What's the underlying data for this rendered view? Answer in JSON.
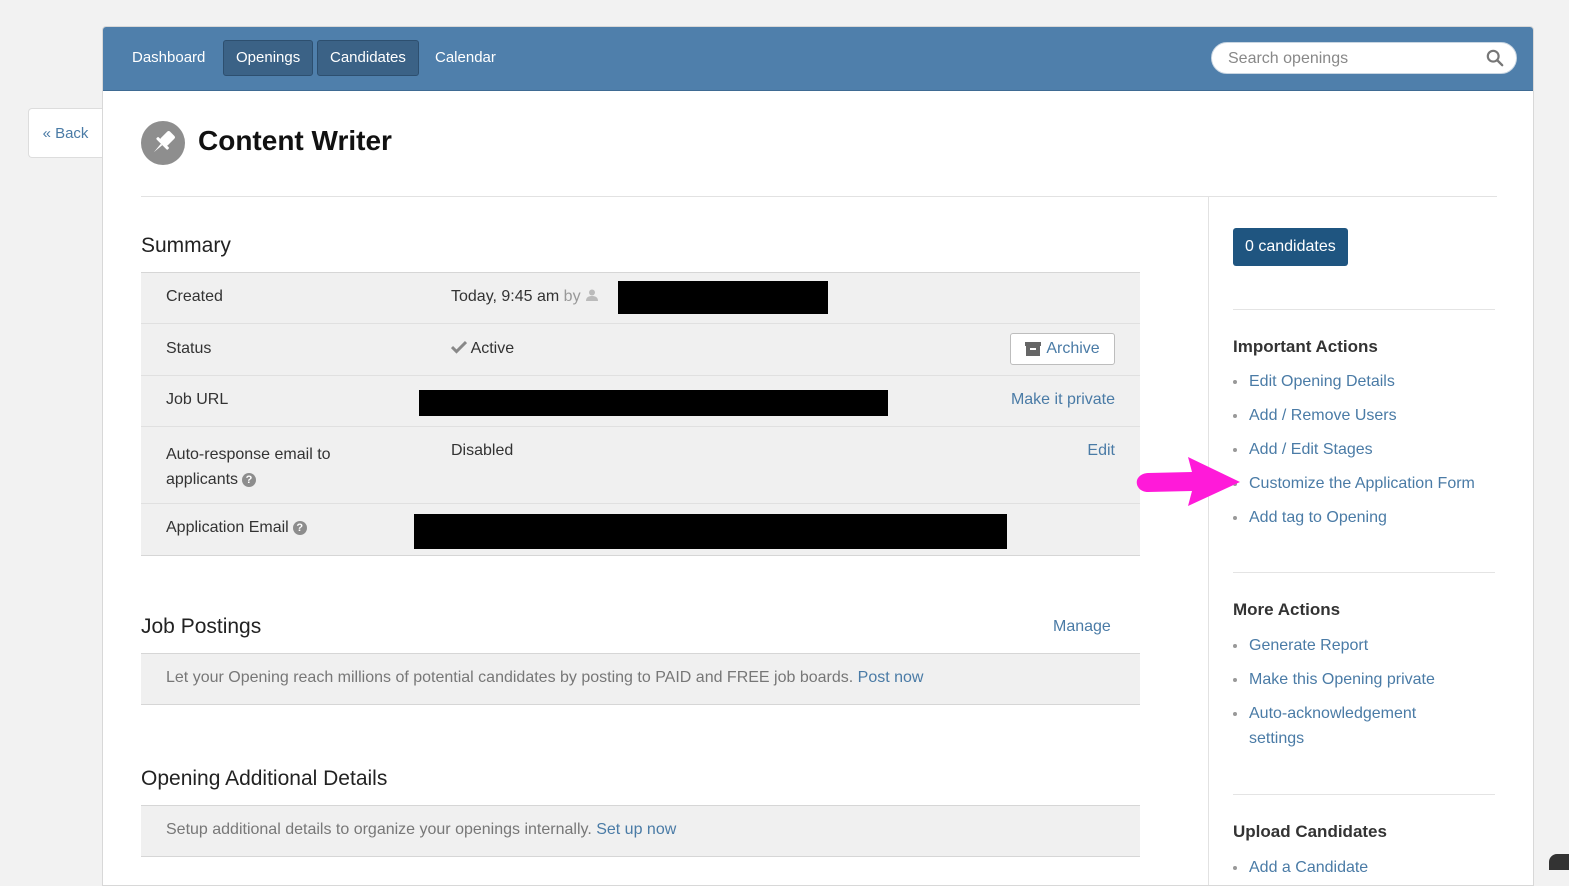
{
  "back": {
    "label": "« Back"
  },
  "nav": {
    "items": [
      {
        "label": "Dashboard"
      },
      {
        "label": "Openings"
      },
      {
        "label": "Candidates"
      },
      {
        "label": "Calendar"
      }
    ],
    "search_placeholder": "Search openings"
  },
  "page": {
    "title": "Content Writer"
  },
  "summary": {
    "heading": "Summary",
    "created_label": "Created",
    "created_value": "Today, 9:45 am",
    "created_by": "by",
    "status_label": "Status",
    "status_value": "Active",
    "archive_label": "Archive",
    "job_url_label": "Job URL",
    "make_private_label": "Make it private",
    "autoresponse_label_line1": "Auto-response email to",
    "autoresponse_label_line2": "applicants",
    "autoresponse_value": "Disabled",
    "edit_label": "Edit",
    "app_email_label": "Application Email"
  },
  "job_postings": {
    "heading": "Job Postings",
    "manage_label": "Manage",
    "note": "Let your Opening reach millions of potential candidates by posting to PAID and FREE job boards.",
    "post_now_label": "Post now"
  },
  "additional": {
    "heading": "Opening Additional Details",
    "note": "Setup additional details to organize your openings internally.",
    "setup_label": "Set up now"
  },
  "sidebar": {
    "candidates_button": "0 candidates",
    "important_heading": "Important Actions",
    "important_items": [
      {
        "label": "Edit Opening Details"
      },
      {
        "label": "Add / Remove Users"
      },
      {
        "label": "Add / Edit Stages"
      },
      {
        "label": "Customize the Application Form"
      },
      {
        "label": "Add tag to Opening"
      }
    ],
    "more_heading": "More Actions",
    "more_items": [
      {
        "label": "Generate Report"
      },
      {
        "label": "Make this Opening private"
      },
      {
        "label": "Auto-acknowledgement settings"
      }
    ],
    "upload_heading": "Upload Candidates",
    "upload_items": [
      {
        "label": "Add a Candidate"
      }
    ]
  },
  "colors": {
    "nav_bg": "#4f7fab",
    "link": "#4a7ba6",
    "primary_button": "#1f5580",
    "annotation_arrow": "#ff1ad9"
  }
}
